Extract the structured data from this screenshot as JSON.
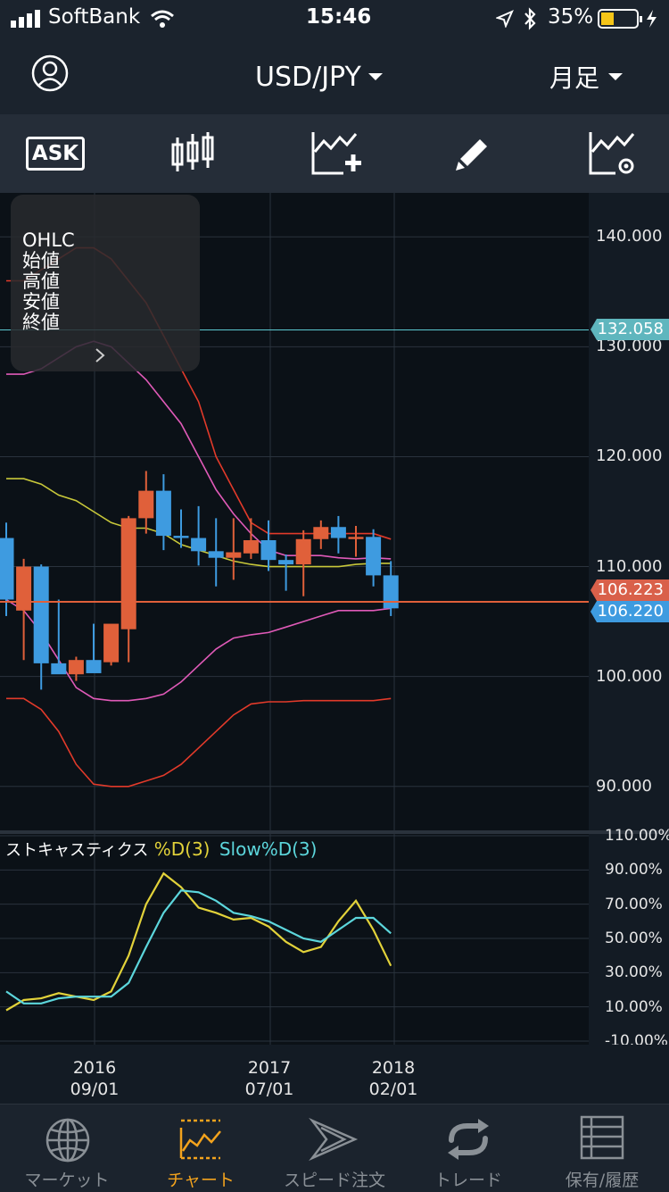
{
  "status": {
    "carrier": "SoftBank",
    "time": "15:46",
    "battery": "35%"
  },
  "header": {
    "pair": "USD/JPY",
    "timeframe": "月足"
  },
  "toolbar": {
    "ask_label": "ASK"
  },
  "overlay": {
    "title": "OHLC",
    "open": "始値",
    "high": "高値",
    "low": "安値",
    "close": "終値"
  },
  "price_axis": {
    "ticks": [
      "140.000",
      "130.000",
      "120.000",
      "110.000",
      "100.000",
      "90.000"
    ],
    "tags": {
      "line_value": "132.058",
      "bid": "106.223",
      "ask": "106.220"
    }
  },
  "oscillator": {
    "label": "ストキャスティクス",
    "pct_d": "%D(3)",
    "slow_pct_d": "Slow%D(3)",
    "ticks": [
      "110.00%",
      "90.00%",
      "70.00%",
      "50.00%",
      "30.00%",
      "10.00%",
      "-10.00%"
    ]
  },
  "date_axis": [
    {
      "year": "2016",
      "date": "09/01"
    },
    {
      "year": "2017",
      "date": "07/01"
    },
    {
      "year": "2018",
      "date": "02/01"
    }
  ],
  "tabs": [
    {
      "label": "マーケット",
      "icon": "globe-icon"
    },
    {
      "label": "チャート",
      "icon": "chart-icon"
    },
    {
      "label": "スピード注文",
      "icon": "speed-order-icon"
    },
    {
      "label": "トレード",
      "icon": "trade-icon"
    },
    {
      "label": "保有/履歴",
      "icon": "history-icon"
    }
  ],
  "colors": {
    "accent": "#f3a31d",
    "up": "#e0603a",
    "down": "#3e9be0",
    "pct_d": "#e2d23a",
    "slow_pct_d": "#5cd6dc"
  },
  "chart_data": [
    {
      "type": "candlestick",
      "title": "USD/JPY",
      "timeframe": "monthly",
      "ylim": [
        86,
        144
      ],
      "y_ticks": [
        140,
        130,
        120,
        110,
        100,
        90
      ],
      "x_labels": [
        "2016 09/01",
        "2017 07/01",
        "2018 02/01"
      ],
      "candles": [
        {
          "o": 112.6,
          "h": 114.0,
          "l": 105.5,
          "c": 107.0
        },
        {
          "o": 106.0,
          "h": 110.7,
          "l": 101.5,
          "c": 110.0
        },
        {
          "o": 110.0,
          "h": 110.2,
          "l": 98.8,
          "c": 101.2
        },
        {
          "o": 101.2,
          "h": 107.0,
          "l": 100.5,
          "c": 100.2
        },
        {
          "o": 100.2,
          "h": 101.8,
          "l": 99.6,
          "c": 101.5
        },
        {
          "o": 101.5,
          "h": 104.8,
          "l": 100.5,
          "c": 100.3
        },
        {
          "o": 101.3,
          "h": 104.0,
          "l": 101.0,
          "c": 104.8
        },
        {
          "o": 104.3,
          "h": 114.6,
          "l": 101.3,
          "c": 114.4
        },
        {
          "o": 114.4,
          "h": 118.7,
          "l": 113.0,
          "c": 116.9
        },
        {
          "o": 116.9,
          "h": 118.4,
          "l": 111.5,
          "c": 112.8
        },
        {
          "o": 112.8,
          "h": 115.2,
          "l": 111.7,
          "c": 112.6
        },
        {
          "o": 112.6,
          "h": 115.5,
          "l": 110.1,
          "c": 111.4
        },
        {
          "o": 111.4,
          "h": 114.4,
          "l": 108.2,
          "c": 110.8
        },
        {
          "o": 110.8,
          "h": 114.4,
          "l": 108.8,
          "c": 111.3
        },
        {
          "o": 111.2,
          "h": 114.4,
          "l": 110.7,
          "c": 112.4
        },
        {
          "o": 112.4,
          "h": 114.2,
          "l": 109.6,
          "c": 110.6
        },
        {
          "o": 110.6,
          "h": 111.1,
          "l": 107.8,
          "c": 110.2
        },
        {
          "o": 110.2,
          "h": 113.3,
          "l": 107.3,
          "c": 112.5
        },
        {
          "o": 112.5,
          "h": 114.2,
          "l": 111.6,
          "c": 113.6
        },
        {
          "o": 113.6,
          "h": 114.6,
          "l": 111.2,
          "c": 112.6
        },
        {
          "o": 112.5,
          "h": 113.7,
          "l": 110.9,
          "c": 112.7
        },
        {
          "o": 112.7,
          "h": 113.4,
          "l": 108.2,
          "c": 109.2
        },
        {
          "o": 109.2,
          "h": 110.5,
          "l": 105.5,
          "c": 106.2
        }
      ],
      "overlays": [
        {
          "name": "upper-band-outer",
          "color": "#e23a2a",
          "values": [
            136,
            136,
            137,
            138,
            139,
            139,
            138,
            136,
            134,
            131,
            128,
            125,
            120,
            117,
            114,
            113,
            113,
            113,
            113,
            113,
            113,
            113,
            112.5
          ]
        },
        {
          "name": "upper-band-inner",
          "color": "#e05ab8",
          "values": [
            127.5,
            127.5,
            128,
            129,
            130,
            130.5,
            130,
            128.5,
            127,
            125,
            123,
            120,
            117,
            114.8,
            113,
            111.5,
            111,
            111,
            111,
            110.8,
            110.7,
            110.8,
            110.7
          ]
        },
        {
          "name": "moving-average",
          "color": "#c8c83a",
          "values": [
            118,
            118,
            117.5,
            116.5,
            116,
            115,
            114,
            113.5,
            113.5,
            113,
            112,
            111.5,
            111,
            110.5,
            110.2,
            110,
            110,
            110,
            110,
            110,
            110.2,
            110.3,
            110.3
          ]
        },
        {
          "name": "lower-band-inner",
          "color": "#e05ab8",
          "values": [
            107,
            106,
            104,
            101.5,
            99,
            98,
            97.8,
            97.8,
            98,
            98.4,
            99.5,
            101,
            102.5,
            103.5,
            103.8,
            104,
            104.5,
            105,
            105.5,
            106,
            106,
            106,
            106.2
          ]
        },
        {
          "name": "lower-band-outer",
          "color": "#e23a2a",
          "values": [
            98,
            98,
            97,
            95,
            92,
            90.2,
            90,
            90,
            90.5,
            91,
            92,
            93.5,
            95,
            96.5,
            97.5,
            97.7,
            97.7,
            97.8,
            97.8,
            97.8,
            97.8,
            97.8,
            98
          ]
        }
      ]
    },
    {
      "type": "line",
      "title": "ストキャスティクス",
      "ylim": [
        -10,
        110
      ],
      "y_ticks": [
        110,
        90,
        70,
        50,
        30,
        10,
        -10
      ],
      "series": [
        {
          "name": "%D(3)",
          "color": "#e2d23a",
          "values": [
            8,
            14,
            15,
            18,
            16,
            14,
            19,
            40,
            70,
            88,
            80,
            68,
            65,
            61,
            62,
            57,
            48,
            42,
            45,
            60,
            72,
            55,
            34
          ]
        },
        {
          "name": "Slow%D(3)",
          "color": "#5cd6dc",
          "values": [
            19,
            12,
            12,
            15,
            16,
            16,
            16,
            24,
            45,
            65,
            78,
            77,
            72,
            65,
            63,
            60,
            55,
            50,
            48,
            55,
            62,
            62,
            53
          ]
        }
      ]
    }
  ]
}
